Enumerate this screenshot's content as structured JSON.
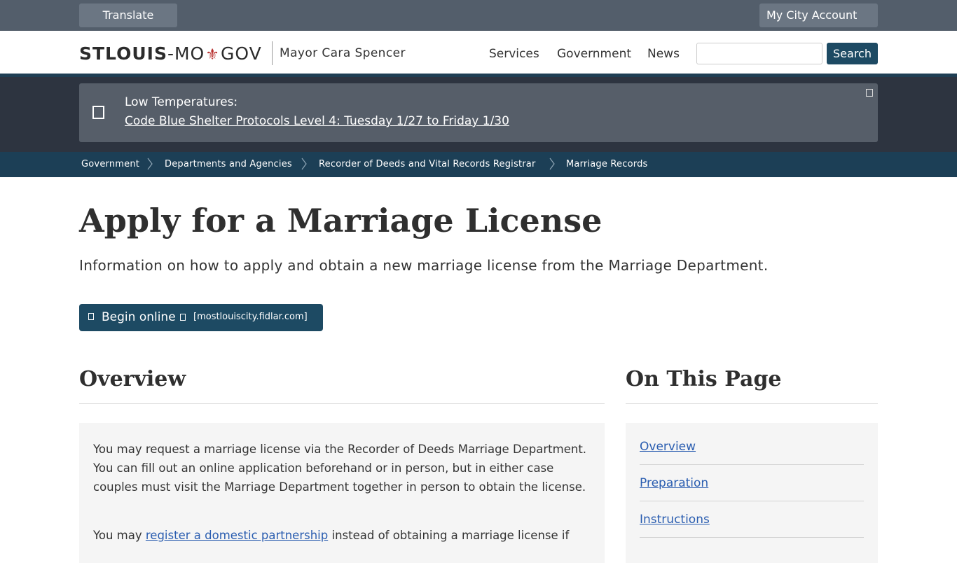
{
  "utility": {
    "translate_label": "Translate",
    "account_label": "My City Account"
  },
  "header": {
    "logo": {
      "part1": "STLOUIS",
      "part2": "-MO",
      "fleur": "⚜",
      "part3": "GOV"
    },
    "mayor": "Mayor Cara Spencer",
    "nav": [
      "Services",
      "Government",
      "News"
    ],
    "search": {
      "value": "",
      "button_label": "Search"
    }
  },
  "alert": {
    "title": "Low Temperatures:",
    "link_text": "Code Blue Shelter Protocols Level 4: Tuesday 1/27 to Friday 1/30"
  },
  "breadcrumb": [
    "Government",
    "Departments and Agencies",
    "Recorder of Deeds and Vital Records Registrar",
    "Marriage Records"
  ],
  "main": {
    "title": "Apply for a Marriage License",
    "subtitle": "Information on how to apply and obtain a new marriage license from the Marriage Department.",
    "begin_button": {
      "label": "Begin online",
      "domain": "[mostlouiscity.fidlar.com]"
    },
    "overview": {
      "heading": "Overview",
      "para1": "You may request a marriage license via the Recorder of Deeds Marriage Department. You can fill out an online application beforehand or in person, but in either case couples must visit the Marriage Department together in person to obtain the license.",
      "para2_prefix": "You may ",
      "para2_link": "register a domestic partnership",
      "para2_suffix": " instead of obtaining a marriage license if"
    },
    "on_this_page": {
      "heading": "On This Page",
      "items": [
        "Overview",
        "Preparation",
        "Instructions"
      ]
    }
  },
  "colors": {
    "utility_bar": "#535e6b",
    "brand_dark": "#1d4a63",
    "breadcrumb_bg": "#1c3f56",
    "alert_bg": "#565e69",
    "link": "#2a5db0",
    "fleur": "#b8312f"
  }
}
